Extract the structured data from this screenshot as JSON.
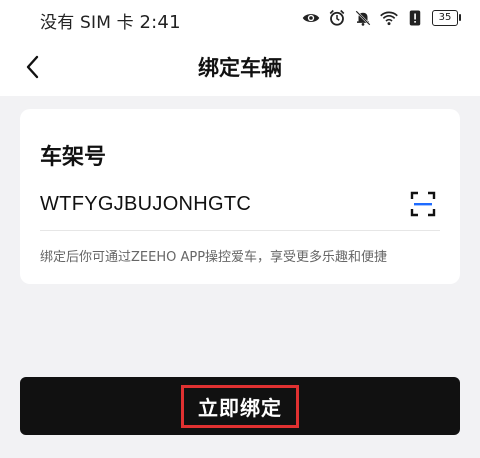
{
  "status_bar": {
    "carrier": "没有 SIM 卡",
    "time": "2:41",
    "battery_level": "35",
    "icons": [
      "eye-icon",
      "alarm-icon",
      "mute-icon",
      "wifi-icon",
      "alert-icon",
      "battery-icon"
    ]
  },
  "header": {
    "back_icon": "chevron-left-icon",
    "title": "绑定车辆"
  },
  "form": {
    "label": "车架号",
    "vin_value": "WTFYGJBUJONHGTC",
    "scan_icon": "scan-icon",
    "hint": "绑定后你可通过ZEEHO APP操控爱车，享受更多乐趣和便捷"
  },
  "actions": {
    "bind_label": "立即绑定"
  },
  "colors": {
    "button_bg": "#111111",
    "highlight_border": "#e03131",
    "scan_accent": "#1e6bff",
    "page_bg": "#f2f2f4"
  }
}
